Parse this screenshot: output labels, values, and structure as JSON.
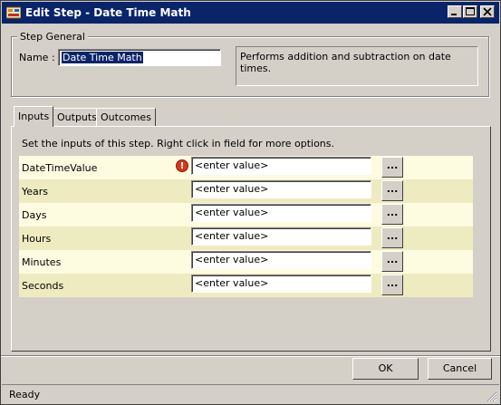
{
  "window": {
    "title": "Edit Step - Date Time Math",
    "app_icon": "app-icon",
    "controls": [
      "minimize-icon",
      "maximize-icon",
      "close-icon"
    ]
  },
  "step_general": {
    "legend": "Step General",
    "name_label": "Name :",
    "name_value": "Date Time Math",
    "description": "Performs addition and subtraction on date times."
  },
  "tabs": [
    {
      "label": "Inputs",
      "active": true
    },
    {
      "label": "Outputs",
      "active": false
    },
    {
      "label": "Outcomes",
      "active": false
    }
  ],
  "inputs_panel": {
    "caption": "Set the inputs of this step.  Right click in field for more options.",
    "rows": [
      {
        "label": "DateTimeValue",
        "value": "<enter value>",
        "warning": true,
        "button": "..."
      },
      {
        "label": "Years",
        "value": "<enter value>",
        "warning": false,
        "button": "..."
      },
      {
        "label": "Days",
        "value": "<enter value>",
        "warning": false,
        "button": "..."
      },
      {
        "label": "Hours",
        "value": "<enter value>",
        "warning": false,
        "button": "..."
      },
      {
        "label": "Minutes",
        "value": "<enter value>",
        "warning": false,
        "button": "..."
      },
      {
        "label": "Seconds",
        "value": "<enter value>",
        "warning": false,
        "button": "..."
      }
    ],
    "warning_glyph": "!"
  },
  "buttons": {
    "ok": "OK",
    "cancel": "Cancel"
  },
  "status": {
    "text": "Ready"
  },
  "colors": {
    "titlebar": "#0a246a",
    "face": "#d4d0c8",
    "row_light": "#fdfbe0",
    "row_dark": "#efebc0",
    "warning": "#d23a1e"
  }
}
